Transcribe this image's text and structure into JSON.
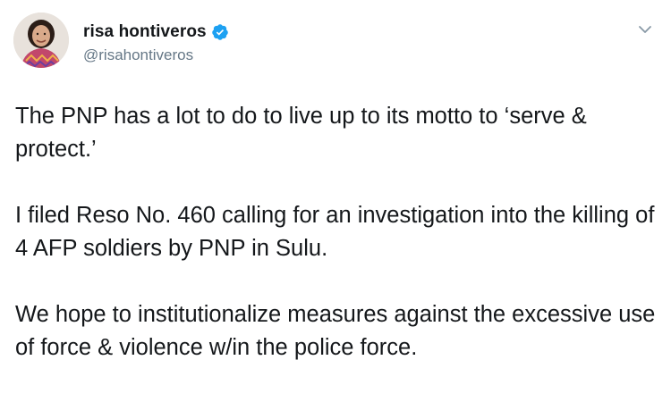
{
  "author": {
    "display_name": "risa hontiveros",
    "handle": "@risahontiveros",
    "verified": true
  },
  "icons": {
    "verified": "verified-badge-icon",
    "menu": "chevron-down-icon"
  },
  "colors": {
    "verified_blue": "#1da1f2",
    "handle_gray": "#657786",
    "text": "#14171a"
  },
  "tweet": {
    "paragraphs": [
      "The PNP has a lot to do to live up to its motto to ‘serve & protect.’",
      "I filed Reso No. 460 calling for an investigation into the killing of 4 AFP soldiers by PNP in Sulu.",
      "We hope to institutionalize measures against the excessive use of force & violence w/in the police force."
    ]
  }
}
